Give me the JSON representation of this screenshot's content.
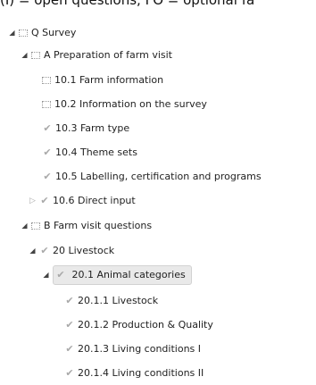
{
  "top_cut_text": "(I) = open questions, FO = optional fa",
  "tree": {
    "q_survey": "Q Survey",
    "a_preparation": "A Preparation of farm visit",
    "a_items": [
      "10.1 Farm information",
      "10.2 Information on the survey",
      "10.3 Farm type",
      "10.4 Theme sets",
      "10.5 Labelling, certification and programs",
      "10.6 Direct input"
    ],
    "b_farm_visit": "B Farm visit questions",
    "livestock_20": "20 Livestock",
    "animal_categories": "20.1 Animal categories",
    "animal_subitems": [
      "20.1.1 Livestock",
      "20.1.2 Production & Quality",
      "20.1.3 Living conditions I",
      "20.1.4 Living conditions II"
    ]
  },
  "icons": {
    "expanded": "triangle-down-right-icon",
    "collapsed": "triangle-right-outline-icon",
    "check": "checkmark-icon",
    "node": "dotted-box-icon"
  },
  "colors": {
    "check": "#a9a9a9",
    "selected_bg": "#e9e9e9"
  }
}
